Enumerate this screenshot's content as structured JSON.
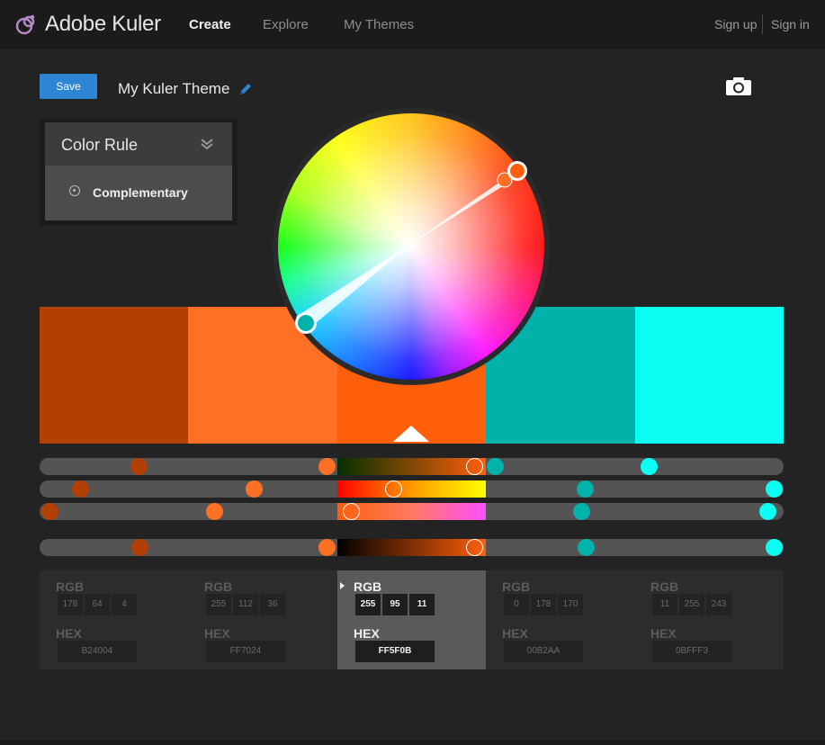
{
  "app": {
    "title": "Adobe Kuler",
    "nav": [
      "Create",
      "Explore",
      "My Themes"
    ],
    "sign_up": "Sign up",
    "sign_in": "Sign in"
  },
  "toolbar": {
    "save_label": "Save",
    "theme_name": "My Kuler Theme"
  },
  "color_rule": {
    "title": "Color Rule",
    "selected": "Complementary"
  },
  "swatches": [
    {
      "hex": "#B24004"
    },
    {
      "hex": "#FF7024"
    },
    {
      "hex": "#FF5F0B"
    },
    {
      "hex": "#00B2AA"
    },
    {
      "hex": "#0BFFF3"
    }
  ],
  "selected_swatch": 2,
  "color_info": [
    {
      "rgb_label": "RGB",
      "r": "178",
      "g": "64",
      "b": "4",
      "hex_label": "HEX",
      "hex": "B24004"
    },
    {
      "rgb_label": "RGB",
      "r": "255",
      "g": "112",
      "b": "36",
      "hex_label": "HEX",
      "hex": "FF7024"
    },
    {
      "rgb_label": "RGB",
      "r": "255",
      "g": "95",
      "b": "11",
      "hex_label": "HEX",
      "hex": "FF5F0B"
    },
    {
      "rgb_label": "RGB",
      "r": "0",
      "g": "178",
      "b": "170",
      "hex_label": "HEX",
      "hex": "00B2AA"
    },
    {
      "rgb_label": "RGB",
      "r": "11",
      "g": "255",
      "b": "243",
      "hex_label": "HEX",
      "hex": "0BFFF3"
    }
  ],
  "colors": {
    "accent": "#2d86d4",
    "topbar": "#1b1b1b",
    "background": "#232323"
  },
  "icons": [
    "kuler-logo-icon",
    "pencil-icon",
    "camera-icon",
    "chevron-down-icon",
    "radio-icon"
  ]
}
